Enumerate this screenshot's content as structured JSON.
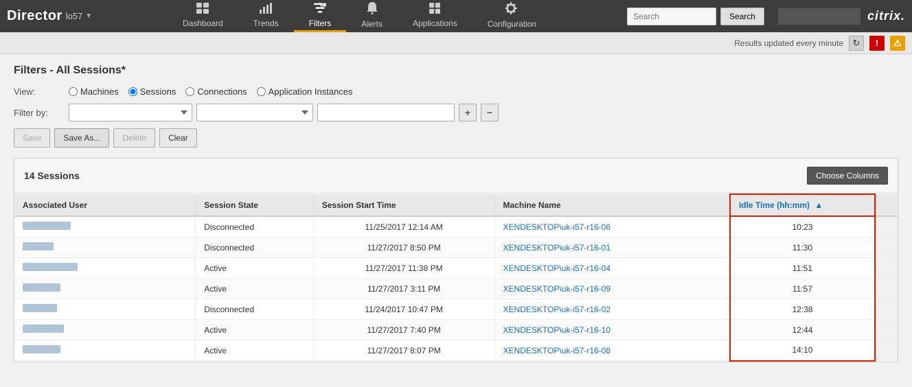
{
  "brand": "Director",
  "site": "lo57",
  "nav": {
    "items": [
      {
        "id": "dashboard",
        "label": "Dashboard",
        "icon": "⊞",
        "active": false
      },
      {
        "id": "trends",
        "label": "Trends",
        "icon": "📊",
        "active": false
      },
      {
        "id": "filters",
        "label": "Filters",
        "icon": "⊞",
        "active": true
      },
      {
        "id": "alerts",
        "label": "Alerts",
        "icon": "🔔",
        "active": false
      },
      {
        "id": "applications",
        "label": "Applications",
        "icon": "⊞",
        "active": false
      },
      {
        "id": "configuration",
        "label": "Configuration",
        "icon": "⚙",
        "active": false
      }
    ],
    "search_placeholder": "Search",
    "search_button": "Search"
  },
  "statusbar": {
    "text": "Results updated every minute",
    "refresh_icon": "↻",
    "error_icon": "!",
    "warn_icon": "⚠"
  },
  "page": {
    "title": "Filters - All Sessions*",
    "view_label": "View:",
    "filter_label": "Filter by:",
    "view_options": [
      {
        "id": "machines",
        "label": "Machines",
        "checked": false
      },
      {
        "id": "sessions",
        "label": "Sessions",
        "checked": true
      },
      {
        "id": "connections",
        "label": "Connections",
        "checked": false
      },
      {
        "id": "app_instances",
        "label": "Application Instances",
        "checked": false
      }
    ],
    "buttons": {
      "save": "Save",
      "save_as": "Save As...",
      "delete": "Delete",
      "clear": "Clear"
    }
  },
  "sessions_table": {
    "title": "14 Sessions",
    "choose_columns_label": "Choose Columns",
    "columns": [
      {
        "id": "associated_user",
        "label": "Associated User",
        "sortable": true,
        "sorted": false
      },
      {
        "id": "session_state",
        "label": "Session State",
        "sortable": true,
        "sorted": false
      },
      {
        "id": "session_start_time",
        "label": "Session Start Time",
        "sortable": true,
        "sorted": false
      },
      {
        "id": "machine_name",
        "label": "Machine Name",
        "sortable": true,
        "sorted": false
      },
      {
        "id": "idle_time",
        "label": "Idle Time (hh:mm)",
        "sortable": true,
        "sorted": true,
        "sort_dir": "asc"
      }
    ],
    "rows": [
      {
        "user_width": 70,
        "state": "Disconnected",
        "start_time": "11/25/2017 12:14 AM",
        "machine": "XENDESKTOP\\uk-i57-r16-06",
        "idle_time": "10:23"
      },
      {
        "user_width": 45,
        "state": "Disconnected",
        "start_time": "11/27/2017 8:50 PM",
        "machine": "XENDESKTOP\\uk-i57-r16-01",
        "idle_time": "11:30"
      },
      {
        "user_width": 80,
        "state": "Active",
        "start_time": "11/27/2017 11:38 PM",
        "machine": "XENDESKTOP\\uk-i57-r16-04",
        "idle_time": "11:51"
      },
      {
        "user_width": 55,
        "state": "Active",
        "start_time": "11/27/2017 3:11 PM",
        "machine": "XENDESKTOP\\uk-i57-r16-09",
        "idle_time": "11:57"
      },
      {
        "user_width": 50,
        "state": "Disconnected",
        "start_time": "11/24/2017 10:47 PM",
        "machine": "XENDESKTOP\\uk-i57-r16-02",
        "idle_time": "12:38"
      },
      {
        "user_width": 60,
        "state": "Active",
        "start_time": "11/27/2017 7:40 PM",
        "machine": "XENDESKTOP\\uk-i57-r16-10",
        "idle_time": "12:44"
      },
      {
        "user_width": 55,
        "state": "Active",
        "start_time": "11/27/2017 8:07 PM",
        "machine": "XENDESKTOP\\uk-i57-r16-08",
        "idle_time": "14:10"
      }
    ]
  }
}
